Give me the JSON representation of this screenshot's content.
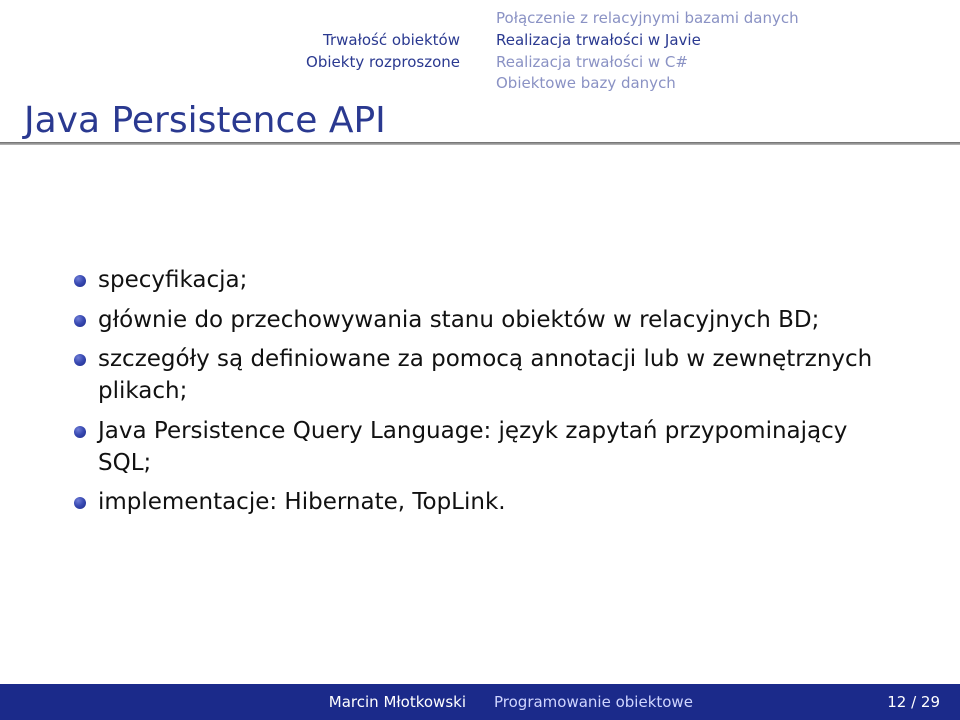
{
  "header": {
    "left_lines": [
      "Trwałość obiektów",
      "Obiekty rozproszone"
    ],
    "right_lines": [
      {
        "text": "Połączenie z relacyjnymi bazami danych",
        "style": "dim"
      },
      {
        "text": "Realizacja trwałości w Javie",
        "style": "bold"
      },
      {
        "text": "Realizacja trwałości w C#",
        "style": "dim"
      },
      {
        "text": "Obiektowe bazy danych",
        "style": "dim"
      }
    ]
  },
  "title": "Java Persistence API",
  "bullets": [
    "specyfikacja;",
    "głównie do przechowywania stanu obiektów w relacyjnych BD;",
    "szczegóły są definiowane za pomocą annotacji lub w zewnętrznych plikach;",
    "Java Persistence Query Language: język zapytań przypominający SQL;",
    "implementacje: Hibernate, TopLink."
  ],
  "footer": {
    "author": "Marcin Młotkowski",
    "talk_title": "Programowanie obiektowe",
    "page": "12 / 29"
  }
}
